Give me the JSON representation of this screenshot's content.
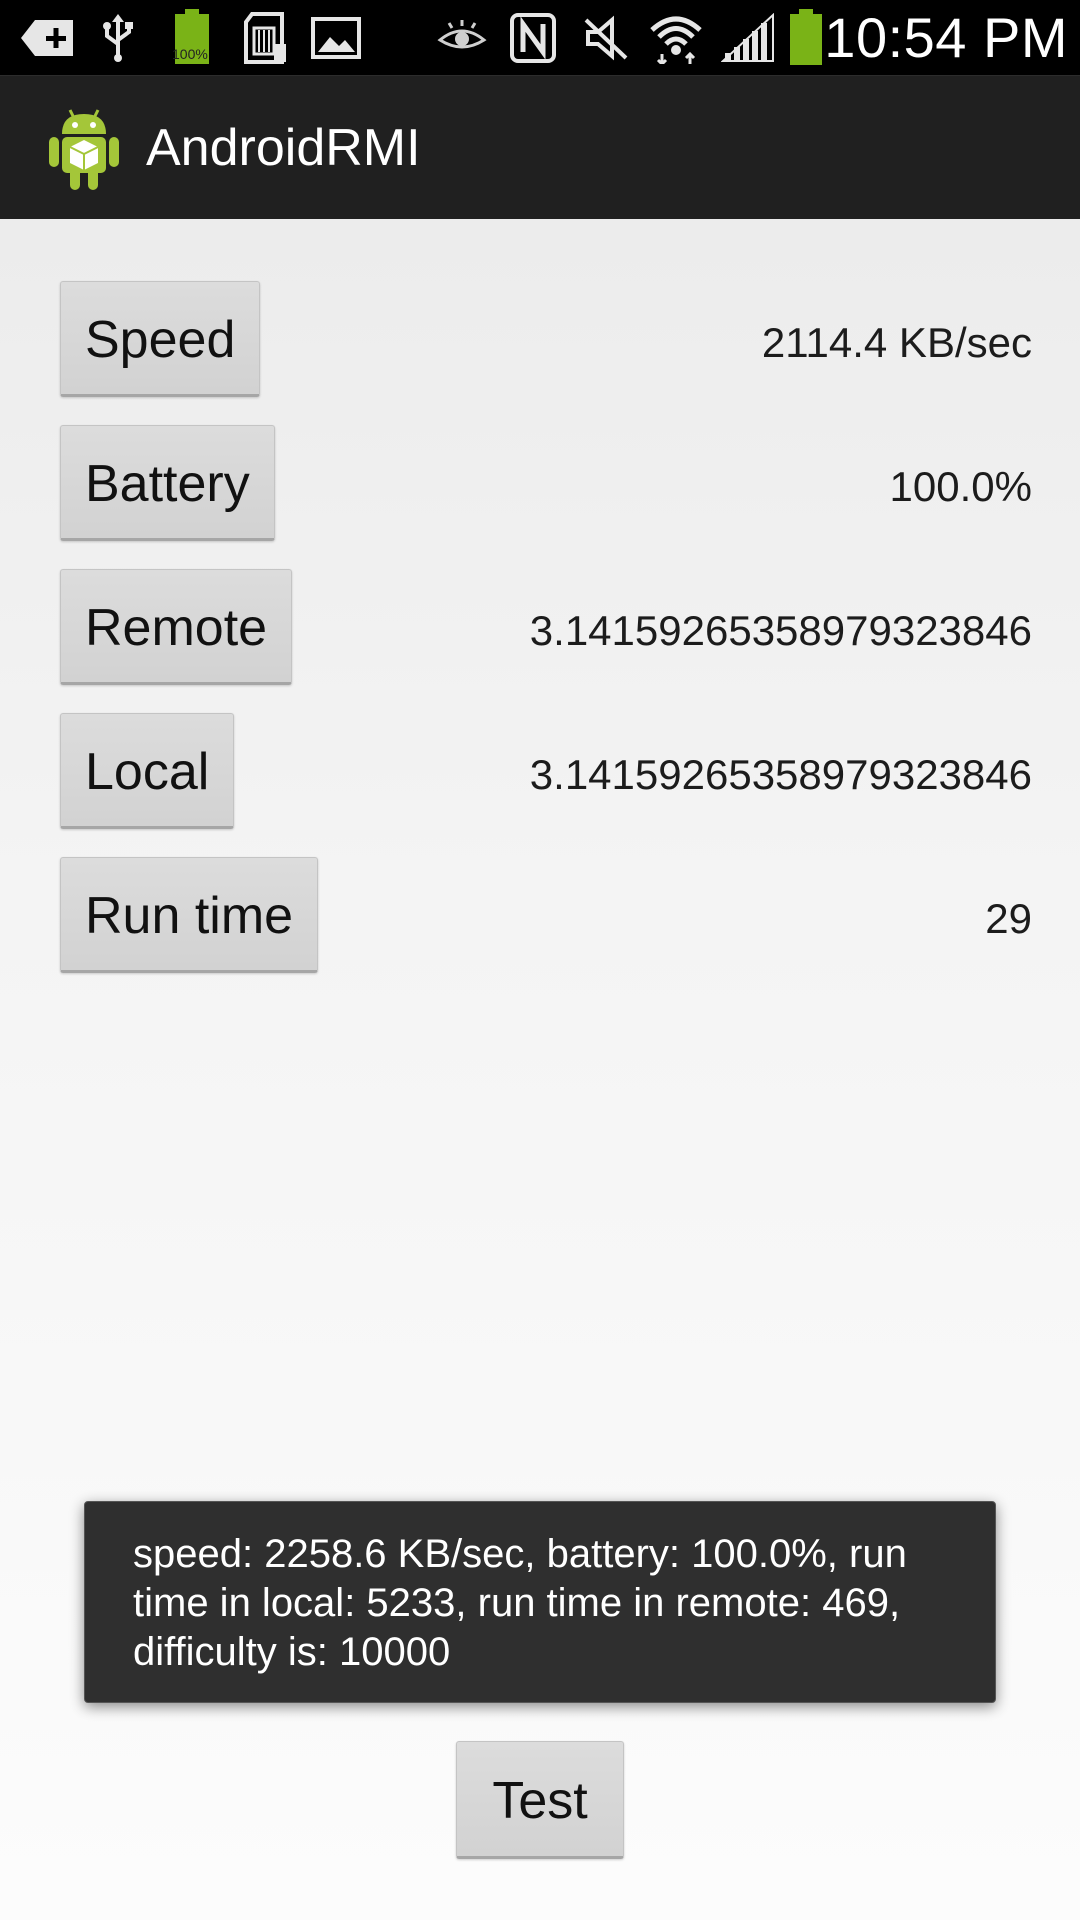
{
  "status_bar": {
    "time": "10:54 PM",
    "battery_icon_label": "100%",
    "left_icons": [
      "add-icon",
      "usb-icon",
      "battery-full-icon",
      "sd-card-icon",
      "gallery-icon"
    ],
    "right_icons": [
      "smart-stay-eye-icon",
      "nfc-icon",
      "mute-icon",
      "wifi-icon",
      "signal-icon",
      "battery-icon"
    ],
    "colors": {
      "battery_green": "#7ab317"
    }
  },
  "action_bar": {
    "title": "AndroidRMI",
    "icon": "android-robot-icon"
  },
  "rows": [
    {
      "button": "Speed",
      "value": "2114.4 KB/sec"
    },
    {
      "button": "Battery",
      "value": "100.0%"
    },
    {
      "button": "Remote",
      "value": "3.14159265358979323846"
    },
    {
      "button": "Local",
      "value": "3.14159265358979323846"
    },
    {
      "button": "Run time",
      "value": "29"
    }
  ],
  "toast": {
    "line1": "speed: 2258.6 KB/sec, battery: 100.0%, run",
    "line2": "time in local: 5233, run time in remote: 469,",
    "line3": "difficulty is: 10000"
  },
  "test_button": {
    "label": "Test"
  }
}
